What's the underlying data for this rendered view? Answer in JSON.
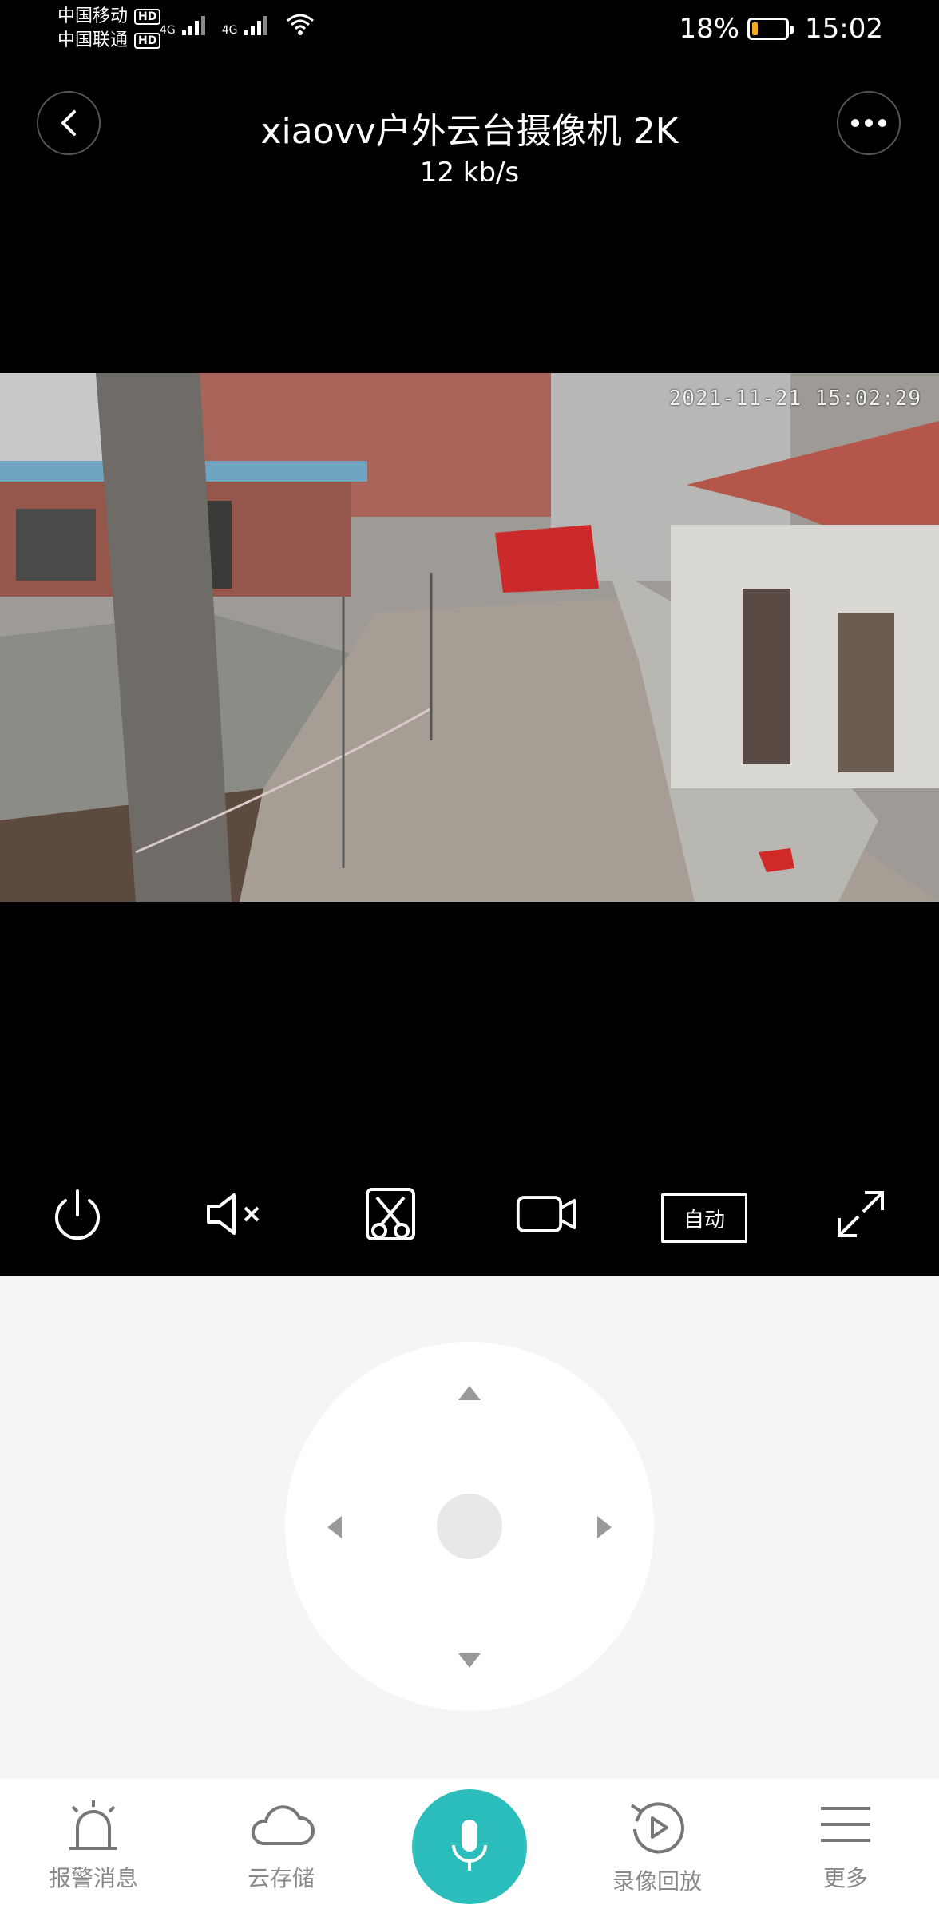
{
  "status_bar": {
    "carrier1": "中国移动",
    "carrier2": "中国联通",
    "hd": "HD",
    "net1": "4G",
    "net2": "4G",
    "battery_pct": "18%",
    "battery_level": 0.18,
    "time": "15:02"
  },
  "header": {
    "title": "xiaovv户外云台摄像机 2K",
    "bitrate": "12 kb/s"
  },
  "video": {
    "timestamp": "2021-11-21 15:02:29"
  },
  "controls": {
    "quality_label": "自动"
  },
  "colors": {
    "accent": "#2bbcbc",
    "battery_low": "#f5a623"
  },
  "nav": {
    "alarm": "报警消息",
    "cloud": "云存储",
    "playback": "录像回放",
    "more": "更多"
  }
}
